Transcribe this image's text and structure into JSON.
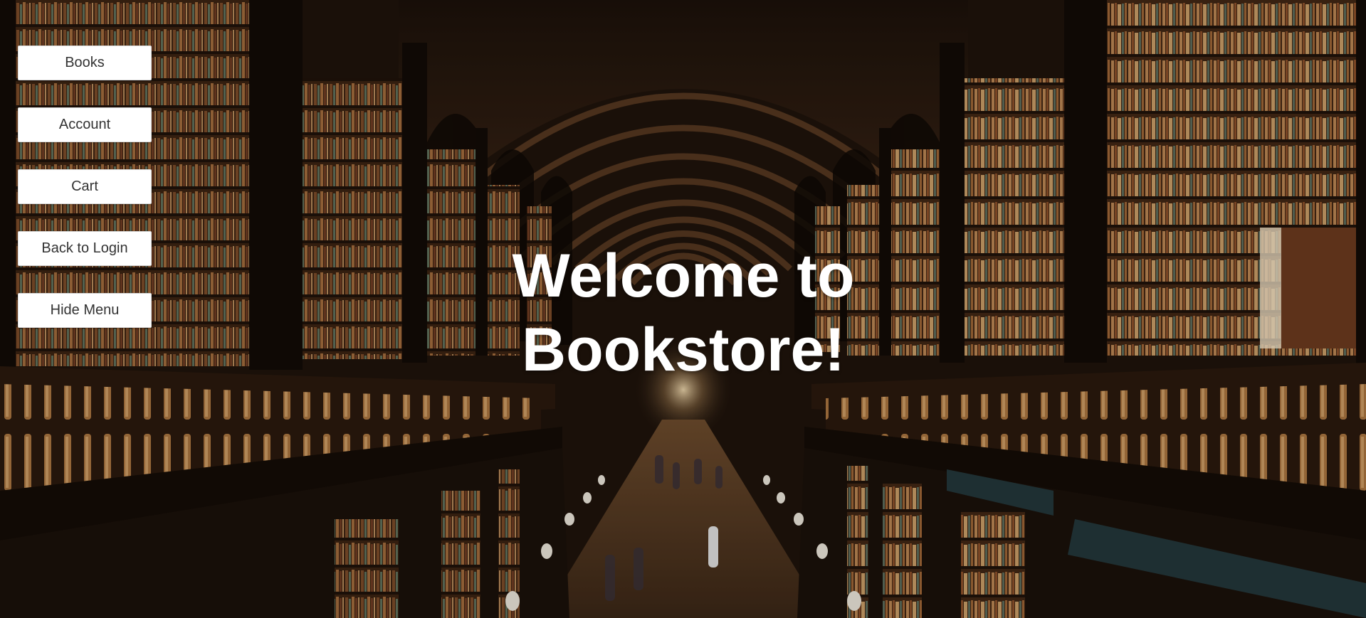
{
  "page": {
    "hero_line_1": "Welcome to",
    "hero_line_2": "Bookstore!"
  },
  "menu": {
    "items": [
      {
        "label": "Books"
      },
      {
        "label": "Account"
      },
      {
        "label": "Cart"
      },
      {
        "label": "Back to Login"
      },
      {
        "label": "Hide Menu"
      }
    ]
  },
  "background": {
    "subject": "long library hall with arched wooden ceiling and tall bookshelves",
    "colors": {
      "ceiling": "#2b1a10",
      "wood_dark": "#1f130b",
      "wood_mid": "#4a2c18",
      "books_warm": "#8a5a34",
      "light": "#f3dcb0"
    }
  }
}
